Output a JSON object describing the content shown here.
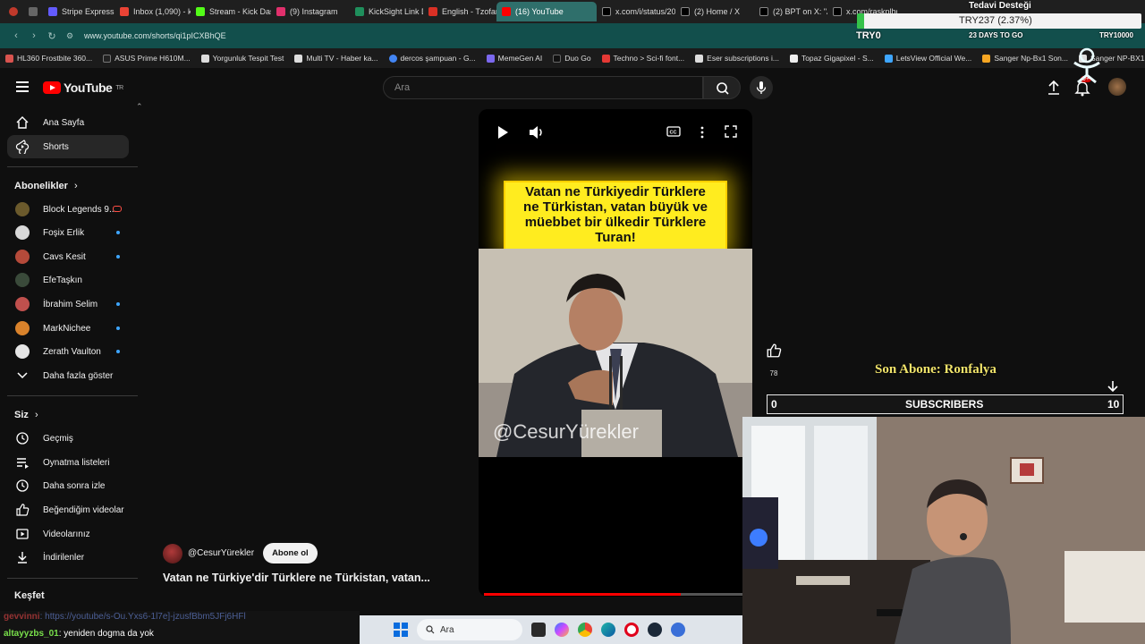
{
  "browser": {
    "tabs": [
      {
        "label": "",
        "color": "#c0392b"
      },
      {
        "label": "",
        "color": "#555"
      },
      {
        "label": "Stripe Express",
        "color": "#635bff"
      },
      {
        "label": "Inbox (1,090) - kick",
        "color": "#ea4335"
      },
      {
        "label": "Stream - Kick Dash",
        "color": "#53fc18"
      },
      {
        "label": "(9) Instagram",
        "color": "#e1306c"
      },
      {
        "label": "KickSight Link Dete",
        "color": "#1f8f5c"
      },
      {
        "label": "English - Tzofar - F",
        "color": "#d93025"
      },
      {
        "label": "(16) YouTube",
        "color": "#ff0000"
      },
      {
        "label": "x.com/i/status/203",
        "color": "#000000"
      },
      {
        "label": "(2) Home / X",
        "color": "#000000"
      },
      {
        "label": "(2) BPT on X: \"Ay",
        "color": "#000000"
      },
      {
        "label": "x.com/raskplhgv/",
        "color": "#000000"
      }
    ],
    "url": "www.youtube.com/shorts/qi1pICXBhQE",
    "bookmarks": [
      "HL360 Frostbite 360...",
      "ASUS Prime H610M...",
      "Yorgunluk Tespit Test",
      "Multi TV - Haber ka...",
      "dercos şampuan - G...",
      "MemeGen AI",
      "Duo Go",
      "Techno > Sci-fi font...",
      "Eser subscriptions i...",
      "Topaz Gigapixel - S...",
      "LetsView Official We...",
      "Sanger Np-Bx1 Son...",
      "Sanger NP-BX1 S"
    ]
  },
  "youtube": {
    "logo_text": "YouTube",
    "logo_region": "TR",
    "search_placeholder": "Ara",
    "notification_count": "9+",
    "sidebar": {
      "home": "Ana Sayfa",
      "shorts": "Shorts",
      "subscriptions_heading": "Abonelikler",
      "channels": [
        {
          "name": "Block Legends 9...",
          "live": true,
          "dot": false,
          "color": "#6b5a2c"
        },
        {
          "name": "Foşix Erlik",
          "live": false,
          "dot": true,
          "color": "#d8d8d8"
        },
        {
          "name": "Cavs Kesit",
          "live": false,
          "dot": true,
          "color": "#b54a3a"
        },
        {
          "name": "EfeTaşkın",
          "live": false,
          "dot": false,
          "color": "#3a4a3a"
        },
        {
          "name": "İbrahim Selim",
          "live": false,
          "dot": true,
          "color": "#c0504d"
        },
        {
          "name": "MarkNichee",
          "live": false,
          "dot": true,
          "color": "#d9822b"
        },
        {
          "name": "Zerath Vaulton",
          "live": false,
          "dot": true,
          "color": "#e6e6e6"
        }
      ],
      "show_more": "Daha fazla göster",
      "you_heading": "Siz",
      "you_items": [
        {
          "label": "Geçmiş",
          "icon": "history-icon"
        },
        {
          "label": "Oynatma listeleri",
          "icon": "playlists-icon"
        },
        {
          "label": "Daha sonra izle",
          "icon": "watch-later-icon"
        },
        {
          "label": "Beğendiğim videolar",
          "icon": "liked-videos-icon"
        },
        {
          "label": "Videolarınız",
          "icon": "your-videos-icon"
        },
        {
          "label": "İndirilenler",
          "icon": "downloads-icon"
        }
      ],
      "explore_heading": "Keşfet"
    },
    "short": {
      "banner_lines": [
        "Vatan ne Türkiyedir Türklere",
        "ne Türkistan, vatan büyük ve",
        "müebbet bir ülkedir Türklere",
        "Turan!"
      ],
      "watermark": "@CesurYürekler",
      "like_count": "78",
      "channel": "@CesurYürekler",
      "subscribe_label": "Abone ol",
      "title": "Vatan ne Türkiye'dir Türklere ne Türkistan, vatan...",
      "progress": 0.76
    }
  },
  "stream_overlay": {
    "tedavi": "Tedavi Desteği",
    "ticker": "TRY237 (2.37%)",
    "ticker_label": "TRY0",
    "countdown": "23 DAYS TO GO",
    "goal": "TRY10000",
    "son_abone": "Son Abone: Ronfalya",
    "subscribers_label": "SUBSCRIBERS",
    "subscribers_current": "0",
    "subscribers_goal": "10"
  },
  "chat": {
    "line1_user": "gevvinni",
    "line1_text": ": https://youtube/s-Ou.Yxs6-1l7e]-jzusfBbm5JFj6HFl",
    "line2_user": "altayyzbs_01",
    "line2_text": ": yeniden dogma da yok"
  },
  "taskbar": {
    "search_placeholder": "Ara"
  }
}
